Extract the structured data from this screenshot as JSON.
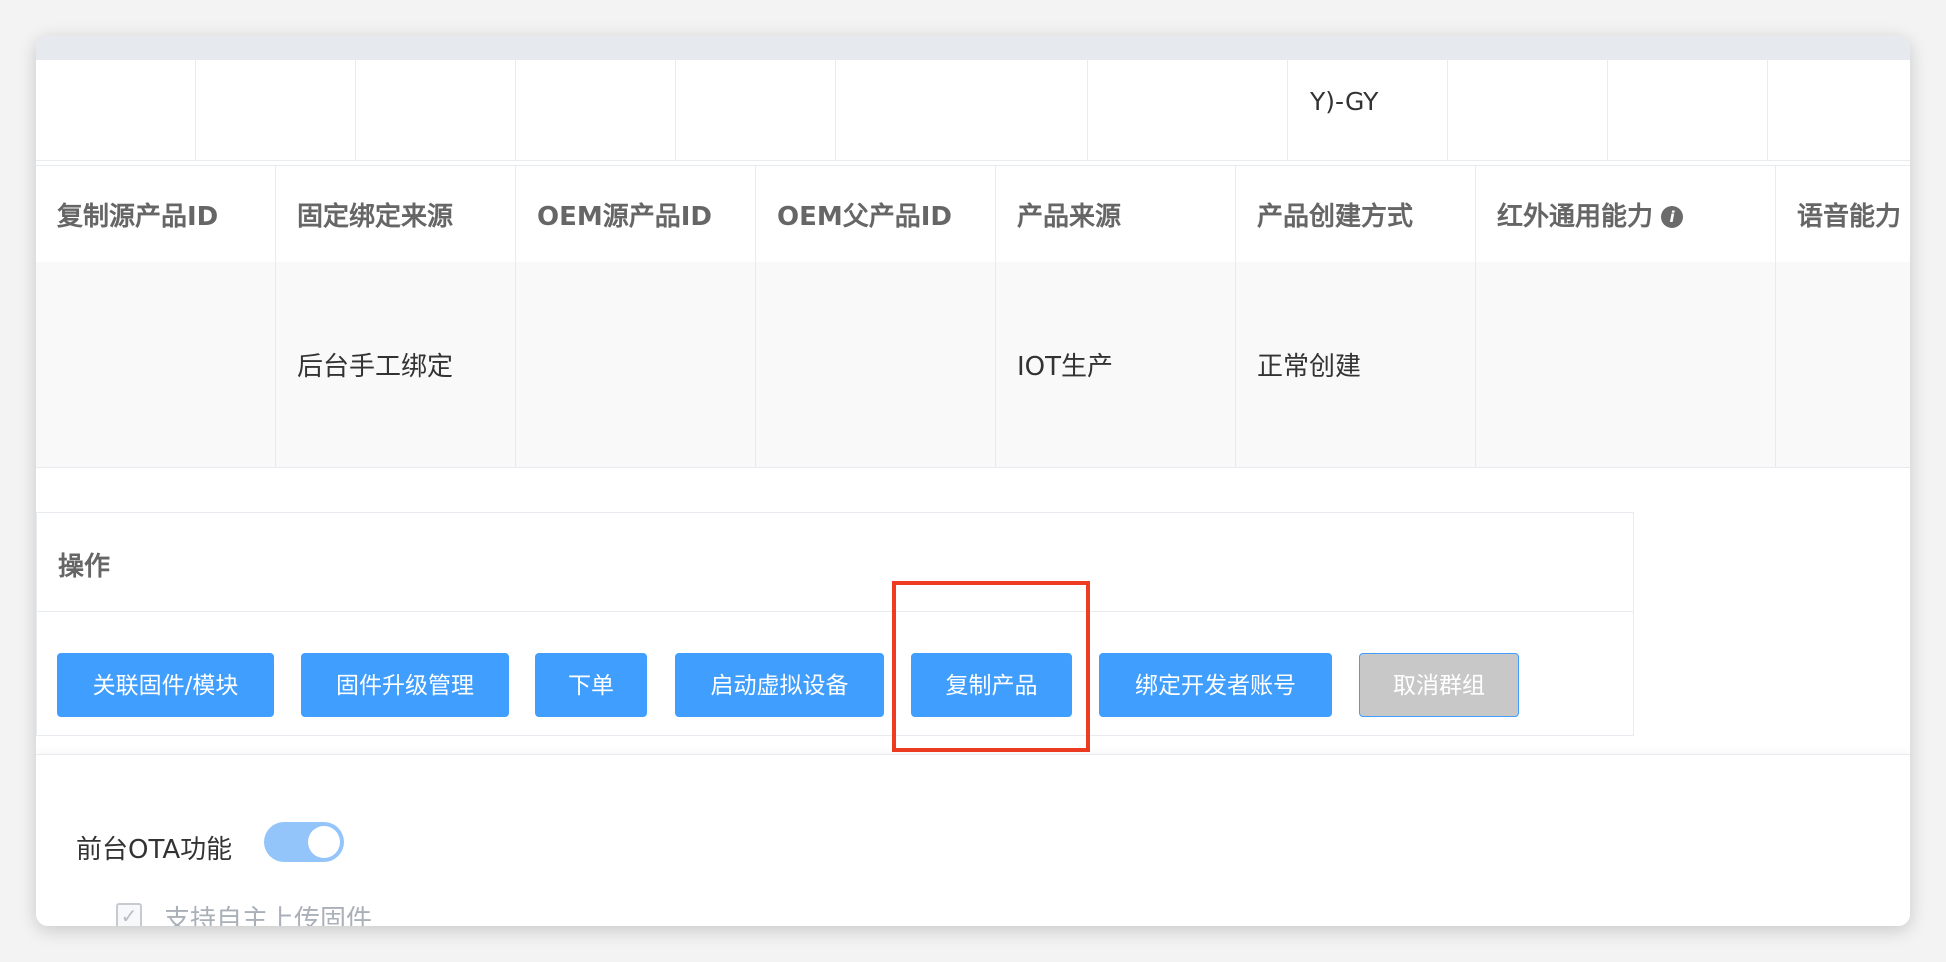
{
  "top_table": {
    "visible_cell_text": "Y)-GY"
  },
  "product_table": {
    "columns": [
      {
        "label": "复制源产品ID",
        "value": ""
      },
      {
        "label": "固定绑定来源",
        "value": "后台手工绑定"
      },
      {
        "label": "OEM源产品ID",
        "value": ""
      },
      {
        "label": "OEM父产品ID",
        "value": ""
      },
      {
        "label": "产品来源",
        "value": "IOT生产"
      },
      {
        "label": "产品创建方式",
        "value": "正常创建"
      },
      {
        "label": "红外通用能力",
        "value": "",
        "has_info_icon": true
      },
      {
        "label": "语音能力",
        "value": ""
      }
    ],
    "info_icon_glyph": "i"
  },
  "operations": {
    "title": "操作",
    "buttons": [
      {
        "label": "关联固件/模块"
      },
      {
        "label": "固件升级管理"
      },
      {
        "label": "下单"
      },
      {
        "label": "启动虚拟设备"
      },
      {
        "label": "复制产品",
        "highlighted": true
      },
      {
        "label": "绑定开发者账号"
      },
      {
        "label": "取消群组",
        "disabled": true
      }
    ]
  },
  "ota": {
    "label": "前台OTA功能",
    "enabled": true,
    "checkbox_label": "支持自主上传固件",
    "checkbox_checked": true
  },
  "colors": {
    "primary": "#409eff",
    "disabled": "#c8c8c8",
    "highlight": "#ee3b21",
    "toggle_on": "#93c5fb"
  }
}
